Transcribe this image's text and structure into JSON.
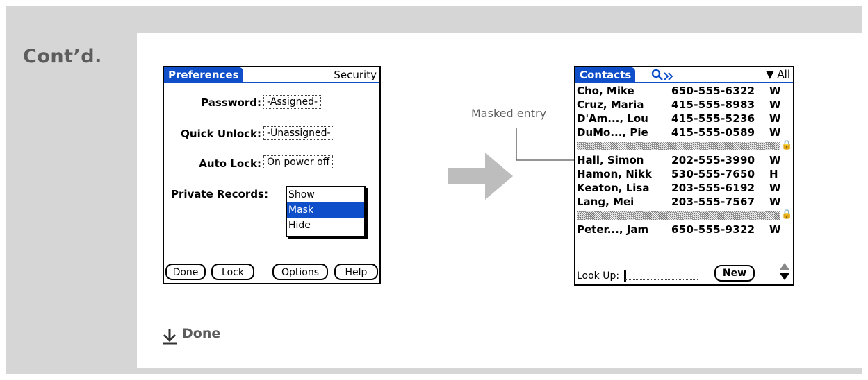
{
  "page": {
    "section_label": "Cont’d.",
    "annotation": "Masked entry",
    "done_label": "Done"
  },
  "prefs": {
    "title": "Preferences",
    "category": "Security",
    "password_label": "Password:",
    "password_value": "-Assigned-",
    "quick_unlock_label": "Quick Unlock:",
    "quick_unlock_value": "-Unassigned-",
    "auto_lock_label": "Auto Lock:",
    "auto_lock_value": "On power off",
    "private_records_label": "Private Records:",
    "private_options": [
      "Show",
      "Mask",
      "Hide"
    ],
    "selected_option": "Mask",
    "buttons": [
      "Done",
      "Lock",
      "Options",
      "Help"
    ]
  },
  "contacts": {
    "title": "Contacts",
    "category": "All",
    "rows": [
      {
        "name": "Cho, Mike",
        "phone": "650-555-6322",
        "type": "W"
      },
      {
        "name": "Cruz, Maria",
        "phone": "415-555-8983",
        "type": "W"
      },
      {
        "name": "D'Am..., Lou",
        "phone": "415-555-5236",
        "type": "W"
      },
      {
        "name": "DuMo..., Pie",
        "phone": "415-555-0589",
        "type": "W"
      },
      {
        "masked": true
      },
      {
        "name": "Hall, Simon",
        "phone": "202-555-3990",
        "type": "W"
      },
      {
        "name": "Hamon, Nikk",
        "phone": "530-555-7650",
        "type": "H"
      },
      {
        "name": "Keaton, Lisa",
        "phone": "203-555-6192",
        "type": "W"
      },
      {
        "name": "Lang, Mei",
        "phone": "203-555-7567",
        "type": "W"
      },
      {
        "masked": true
      },
      {
        "name": "Peter..., Jam",
        "phone": "650-555-9322",
        "type": "W"
      }
    ],
    "lookup_label": "Look Up:",
    "new_button": "New"
  },
  "colors": {
    "accent": "#0f4fc9",
    "frame": "#d6d6d6",
    "label_gray": "#5c5c5c",
    "arrow": "#bdbdbd"
  },
  "icons": {
    "key": "key-icon",
    "lock": "lock-icon",
    "arrow": "right-arrow-icon",
    "done": "down-arrow-icon"
  }
}
